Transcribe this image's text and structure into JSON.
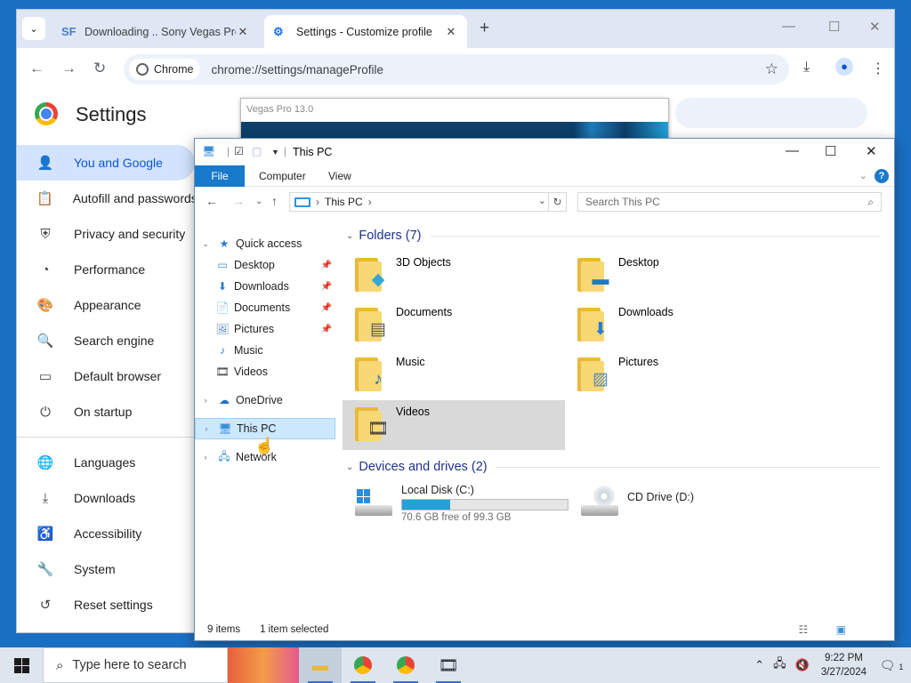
{
  "chrome": {
    "tabs": [
      {
        "favicon": "SF",
        "title": "Downloading .. Sony Vegas Pro",
        "close": "✕"
      },
      {
        "favicon": "gear-icon",
        "title": "Settings - Customize profile",
        "close": "✕"
      }
    ],
    "new_tab": "+",
    "omnibox_chip": "Chrome",
    "url": "chrome://settings/manageProfile",
    "settings_title": "Settings",
    "sidebar": [
      {
        "icon": "person-icon",
        "label": "You and Google",
        "selected": true
      },
      {
        "icon": "clipboard-icon",
        "label": "Autofill and passwords"
      },
      {
        "icon": "shield-icon",
        "label": "Privacy and security"
      },
      {
        "icon": "speedometer-icon",
        "label": "Performance"
      },
      {
        "icon": "palette-icon",
        "label": "Appearance"
      },
      {
        "icon": "search-icon",
        "label": "Search engine"
      },
      {
        "icon": "browser-icon",
        "label": "Default browser"
      },
      {
        "icon": "power-icon",
        "label": "On startup"
      }
    ],
    "sidebar_advanced": [
      {
        "icon": "globe-icon",
        "label": "Languages"
      },
      {
        "icon": "download-icon",
        "label": "Downloads"
      },
      {
        "icon": "accessibility-icon",
        "label": "Accessibility"
      },
      {
        "icon": "wrench-icon",
        "label": "System"
      },
      {
        "icon": "reset-icon",
        "label": "Reset settings"
      }
    ]
  },
  "vegas_popup": {
    "title": "Vegas Pro 13.0"
  },
  "explorer": {
    "window_title": "This PC",
    "ribbon_tabs": [
      "File",
      "Computer",
      "View"
    ],
    "address_path": "This PC",
    "search_placeholder": "Search This PC",
    "nav": {
      "quick_access": "Quick access",
      "quick_items": [
        {
          "label": "Desktop",
          "icon": "desktop-icon",
          "pinned": true
        },
        {
          "label": "Downloads",
          "icon": "download-arrow-icon",
          "pinned": true
        },
        {
          "label": "Documents",
          "icon": "document-icon",
          "pinned": true
        },
        {
          "label": "Pictures",
          "icon": "picture-icon",
          "pinned": true
        },
        {
          "label": "Music",
          "icon": "music-note-icon",
          "pinned": false
        },
        {
          "label": "Videos",
          "icon": "film-icon",
          "pinned": false
        }
      ],
      "onedrive": "OneDrive",
      "this_pc": "This PC",
      "network": "Network"
    },
    "folders_header": "Folders (7)",
    "folders": [
      {
        "label": "3D Objects",
        "icon": "cube-icon"
      },
      {
        "label": "Desktop",
        "icon": "desktop-icon"
      },
      {
        "label": "Documents",
        "icon": "document-icon"
      },
      {
        "label": "Downloads",
        "icon": "download-arrow-icon"
      },
      {
        "label": "Music",
        "icon": "music-note-icon"
      },
      {
        "label": "Pictures",
        "icon": "picture-icon"
      },
      {
        "label": "Videos",
        "icon": "film-icon",
        "selected": true
      }
    ],
    "drives_header": "Devices and drives (2)",
    "drives": [
      {
        "label": "Local Disk (C:)",
        "free_text": "70.6 GB free of 99.3 GB",
        "used_fraction": 0.289,
        "icon": "windows-drive-icon"
      },
      {
        "label": "CD Drive (D:)",
        "icon": "cd-drive-icon"
      }
    ],
    "status": {
      "items": "9 items",
      "selected": "1 item selected"
    }
  },
  "taskbar": {
    "search_placeholder": "Type here to search",
    "apps": [
      "file-explorer-icon",
      "chrome-profile-icon",
      "chrome-icon",
      "film-icon"
    ],
    "time": "9:22 PM",
    "date": "3/27/2024",
    "notifications": "1"
  },
  "colors": {
    "accent": "#1979ca",
    "chrome_selected": "#d3e3fd",
    "folder": "#f8d775",
    "drive_bar": "#26a0da"
  }
}
